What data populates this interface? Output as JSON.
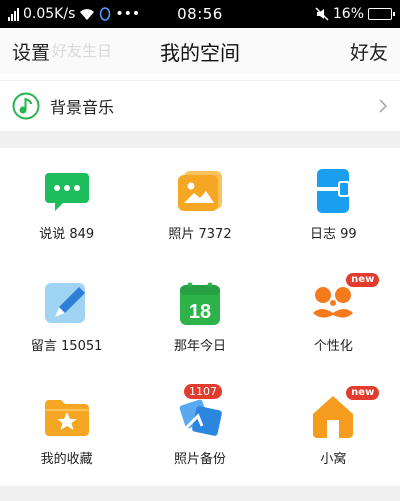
{
  "status_bar": {
    "speed": "0.05K/s",
    "time": "08:56",
    "battery": "16%",
    "battery_level": 0.16,
    "dots": "•••"
  },
  "header": {
    "left_button": "设置",
    "faint_text": "好友生日",
    "title": "我的空间",
    "right_button": "好友"
  },
  "music": {
    "label": "背景音乐",
    "icon": "music-note-icon",
    "accent": "#27b44e"
  },
  "grid": [
    {
      "label": "说说 849",
      "icon": "chat-bubble-icon",
      "color": "#1dbc5c"
    },
    {
      "label": "照片 7372",
      "icon": "photo-icon",
      "color": "#f5a623"
    },
    {
      "label": "日志 99",
      "icon": "journal-icon",
      "color": "#1a9ef0"
    },
    {
      "label": "留言 15051",
      "icon": "pen-icon",
      "color": "#3b8fe6"
    },
    {
      "label": "那年今日",
      "icon": "calendar-icon",
      "color": "#2db34a",
      "day": "18"
    },
    {
      "label": "个性化",
      "icon": "mustache-face-icon",
      "color": "#f57a1e",
      "badge": "new"
    },
    {
      "label": "我的收藏",
      "icon": "star-folder-icon",
      "color": "#f5a623"
    },
    {
      "label": "照片备份",
      "icon": "photo-backup-icon",
      "color": "#2b86e0",
      "badge": "1107"
    },
    {
      "label": "小窝",
      "icon": "house-icon",
      "color": "#f59b1e",
      "badge": "new"
    }
  ]
}
